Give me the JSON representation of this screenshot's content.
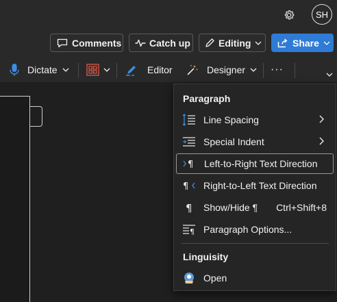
{
  "header": {
    "avatar_initials": "SH",
    "settings_icon": "gear-icon"
  },
  "actions": {
    "comments_label": "Comments",
    "catchup_label": "Catch up",
    "editing_label": "Editing",
    "share_label": "Share"
  },
  "toolbar": {
    "dictate_label": "Dictate",
    "editor_label": "Editor",
    "designer_label": "Designer",
    "more_label": "···"
  },
  "menu": {
    "paragraph_header": "Paragraph",
    "items": [
      {
        "label": "Line Spacing",
        "icon": "line-spacing-icon"
      },
      {
        "label": "Special Indent",
        "icon": "special-indent-icon"
      },
      {
        "label": "Left-to-Right Text Direction",
        "icon": "ltr-direction-icon"
      },
      {
        "label": "Right-to-Left Text Direction",
        "icon": "rtl-direction-icon"
      },
      {
        "label": "Show/Hide ¶",
        "icon": "pilcrow-icon",
        "shortcut": "Ctrl+Shift+8"
      },
      {
        "label": "Paragraph Options...",
        "icon": "paragraph-options-icon"
      }
    ],
    "linguisity_header": "Linguisity",
    "open_label": "Open"
  },
  "colors": {
    "accent": "#2f7bd5",
    "background": "#1f1f1f",
    "menu_background": "#252525"
  }
}
